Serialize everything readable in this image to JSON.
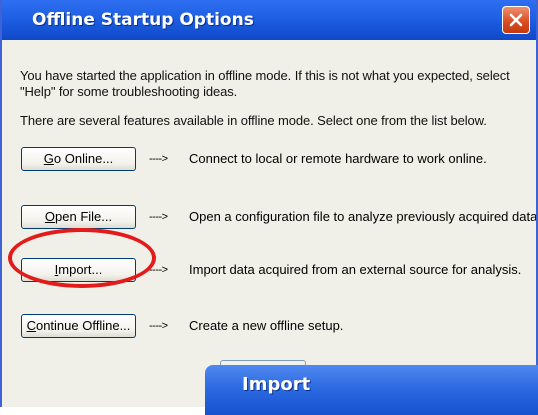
{
  "window": {
    "title": "Offline Startup Options"
  },
  "messages": {
    "intro": "You have started the application in offline mode. If this is not what you expected, select \"Help\" for some troubleshooting ideas.",
    "features": "There are several features available in offline mode. Select one from the list below."
  },
  "options": [
    {
      "hotkey": "G",
      "label_rest": "o Online...",
      "arrow": "---->",
      "description": "Connect to local or remote hardware to work online."
    },
    {
      "hotkey": "O",
      "label_rest": "pen File...",
      "arrow": "---->",
      "description": "Open a configuration file to analyze previously acquired data."
    },
    {
      "hotkey": "I",
      "label_rest": "mport...",
      "arrow": "---->",
      "description": "Import data acquired from an external source for analysis."
    },
    {
      "hotkey": "C",
      "label_rest": "ontinue Offline...",
      "arrow": "---->",
      "description": "Create a new offline setup."
    }
  ],
  "import_window": {
    "title": "Import"
  },
  "colors": {
    "titlebar": "#1e5fe3",
    "window_bg": "#f0f0e8",
    "highlight": "#e31b1b",
    "close_button": "#d94a1e"
  },
  "icons": {
    "close": "close-icon"
  }
}
